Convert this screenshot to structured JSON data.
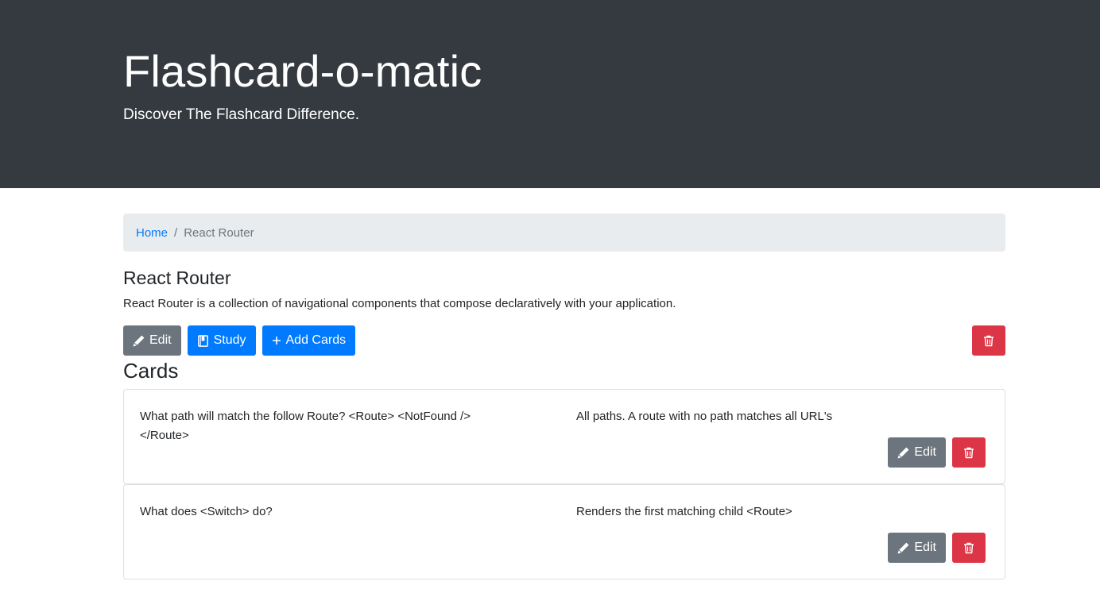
{
  "header": {
    "title": "Flashcard-o-matic",
    "lead": "Discover The Flashcard Difference."
  },
  "breadcrumb": {
    "home": "Home",
    "separator": "/",
    "current": "React Router"
  },
  "deck": {
    "name": "React Router",
    "description": "React Router is a collection of navigational components that compose declaratively with your application.",
    "edit_label": "Edit",
    "study_label": "Study",
    "add_cards_label": "Add Cards"
  },
  "cards_heading": "Cards",
  "cards": [
    {
      "front": "What path will match the follow Route? <Route> <NotFound /> </Route>",
      "back": "All paths. A route with no path matches all URL's",
      "edit_label": "Edit"
    },
    {
      "front": "What does <Switch> do?",
      "back": "Renders the first matching child <Route>",
      "edit_label": "Edit"
    }
  ],
  "colors": {
    "header_bg": "#343a40",
    "primary": "#007bff",
    "secondary": "#6c757d",
    "danger": "#dc3545",
    "breadcrumb_bg": "#e9ecef"
  },
  "icons": {
    "edit": "pencil-icon",
    "study": "book-icon",
    "add": "plus-icon",
    "delete": "trash-icon"
  }
}
